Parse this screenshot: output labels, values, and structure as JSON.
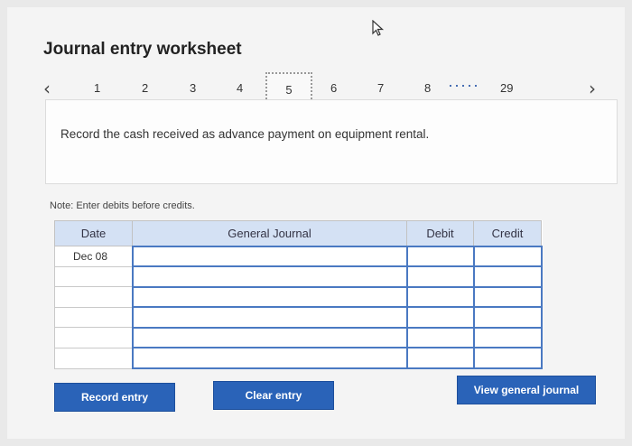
{
  "worksheet": {
    "title": "Journal entry worksheet"
  },
  "nav": {
    "prev_icon": "‹",
    "next_icon": "›",
    "pages": [
      "1",
      "2",
      "3",
      "4",
      "6",
      "7",
      "8"
    ],
    "current_page": "5",
    "ellipsis": "·····",
    "last_page": "29"
  },
  "prompt": {
    "text": "Record the cash received as advance payment on equipment rental."
  },
  "note": "Note: Enter debits before credits.",
  "journal": {
    "headers": {
      "date": "Date",
      "general_journal": "General Journal",
      "debit": "Debit",
      "credit": "Credit"
    },
    "rows": [
      {
        "date": "Dec 08",
        "account": "",
        "debit": "",
        "credit": ""
      },
      {
        "date": "",
        "account": "",
        "debit": "",
        "credit": ""
      },
      {
        "date": "",
        "account": "",
        "debit": "",
        "credit": ""
      },
      {
        "date": "",
        "account": "",
        "debit": "",
        "credit": ""
      },
      {
        "date": "",
        "account": "",
        "debit": "",
        "credit": ""
      },
      {
        "date": "",
        "account": "",
        "debit": "",
        "credit": ""
      }
    ]
  },
  "buttons": {
    "record": "Record entry",
    "clear": "Clear entry",
    "view": "View general journal"
  },
  "colors": {
    "button": "#2a63b8",
    "header": "#d4e1f4",
    "input_border": "#4a79c2"
  }
}
